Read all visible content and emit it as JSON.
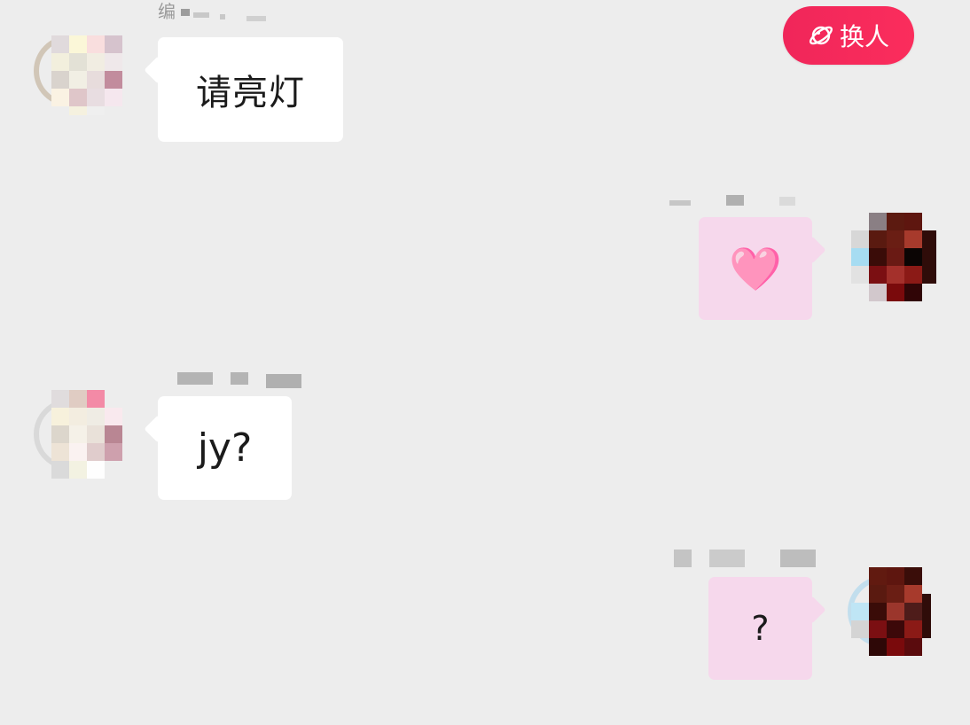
{
  "header": {
    "switch_button_label": "换人",
    "switch_icon": "planet-icon",
    "accent_color": "#f0265a"
  },
  "messages": [
    {
      "side": "left",
      "sender_label": "编",
      "text": "请亮灯"
    },
    {
      "side": "right",
      "sender_label": "",
      "text": "🩷"
    },
    {
      "side": "left",
      "sender_label": "",
      "text": "jy?"
    },
    {
      "side": "right",
      "sender_label": "",
      "text": "?"
    }
  ],
  "colors": {
    "background": "#ededed",
    "incoming_bubble": "#ffffff",
    "outgoing_bubble": "#f6d8ec"
  }
}
